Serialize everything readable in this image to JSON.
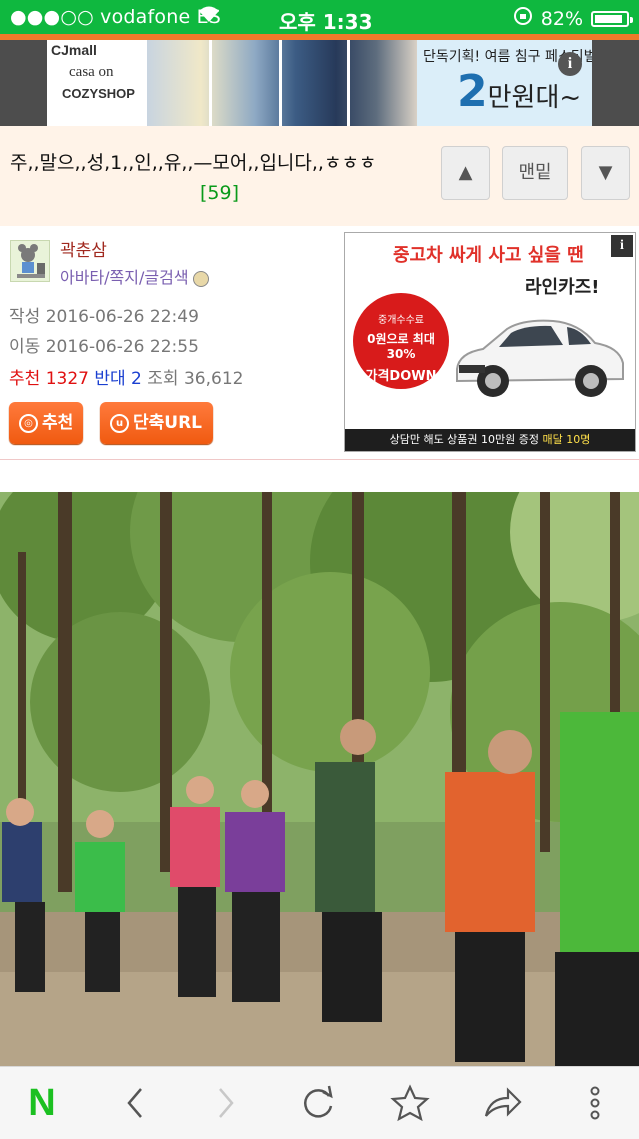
{
  "status_bar": {
    "carrier": "●●●○○ vodafone ES",
    "time": "오후 1:33",
    "battery": "82%",
    "battery_level": 0.82
  },
  "top_ad": {
    "logo_1": "CJmall",
    "logo_2": "casa on",
    "logo_3": "COZYSHOP",
    "headline": "단독기획! 여름 침구 페스티벌",
    "price_big": "2",
    "price_rest": "만원대~",
    "info_icon": "info-icon"
  },
  "post_header": {
    "title": "주,,말으,,성,1,,인,,유,,—모어,,입니다,,ㅎㅎㅎ",
    "reply_count": "[59]",
    "btn_up": "▲",
    "btn_bottom": "맨밑",
    "btn_down": "▼"
  },
  "post_info": {
    "author": "곽춘삼",
    "author_links": "아바타/쪽지/글검색",
    "written_label": "작성",
    "written_date": "2016-06-26 22:49",
    "moved_label": "이동",
    "moved_date": "2016-06-26 22:55",
    "recommend_label": "추천",
    "recommend_count": "1327",
    "oppose_label": "반대",
    "oppose_count": "2",
    "views_label": "조회",
    "views_count": "36,612",
    "recommend_button": "추천",
    "short_url_button": "단축URL"
  },
  "car_ad": {
    "headline": "중고차 싸게 사고 싶을 땐",
    "brand": "라인카즈!",
    "seal_line1": "중개수수료",
    "seal_line2": "0원으로 최대 30%",
    "seal_line3": "가격DOWN",
    "footer_a": "상담만 해도 상품권 10만원 증정",
    "footer_b": "매달 10명",
    "info_icon": "info-icon"
  },
  "toolbar": {
    "naver": "N",
    "icons": [
      "back-icon",
      "forward-icon",
      "reload-icon",
      "bookmark-icon",
      "share-icon",
      "more-icon"
    ]
  },
  "colors": {
    "status_green": "#0fb83f",
    "accent_orange": "#f07a2a",
    "title_bg": "#fff3e8",
    "reply_green": "#0a9a1a",
    "author_red": "#a0281e",
    "link_purple": "#7a5fb0",
    "recommend_red": "#e01010",
    "oppose_blue": "#1a3fd0",
    "button_orange": "#f05a10",
    "naver_green": "#1bc021"
  }
}
